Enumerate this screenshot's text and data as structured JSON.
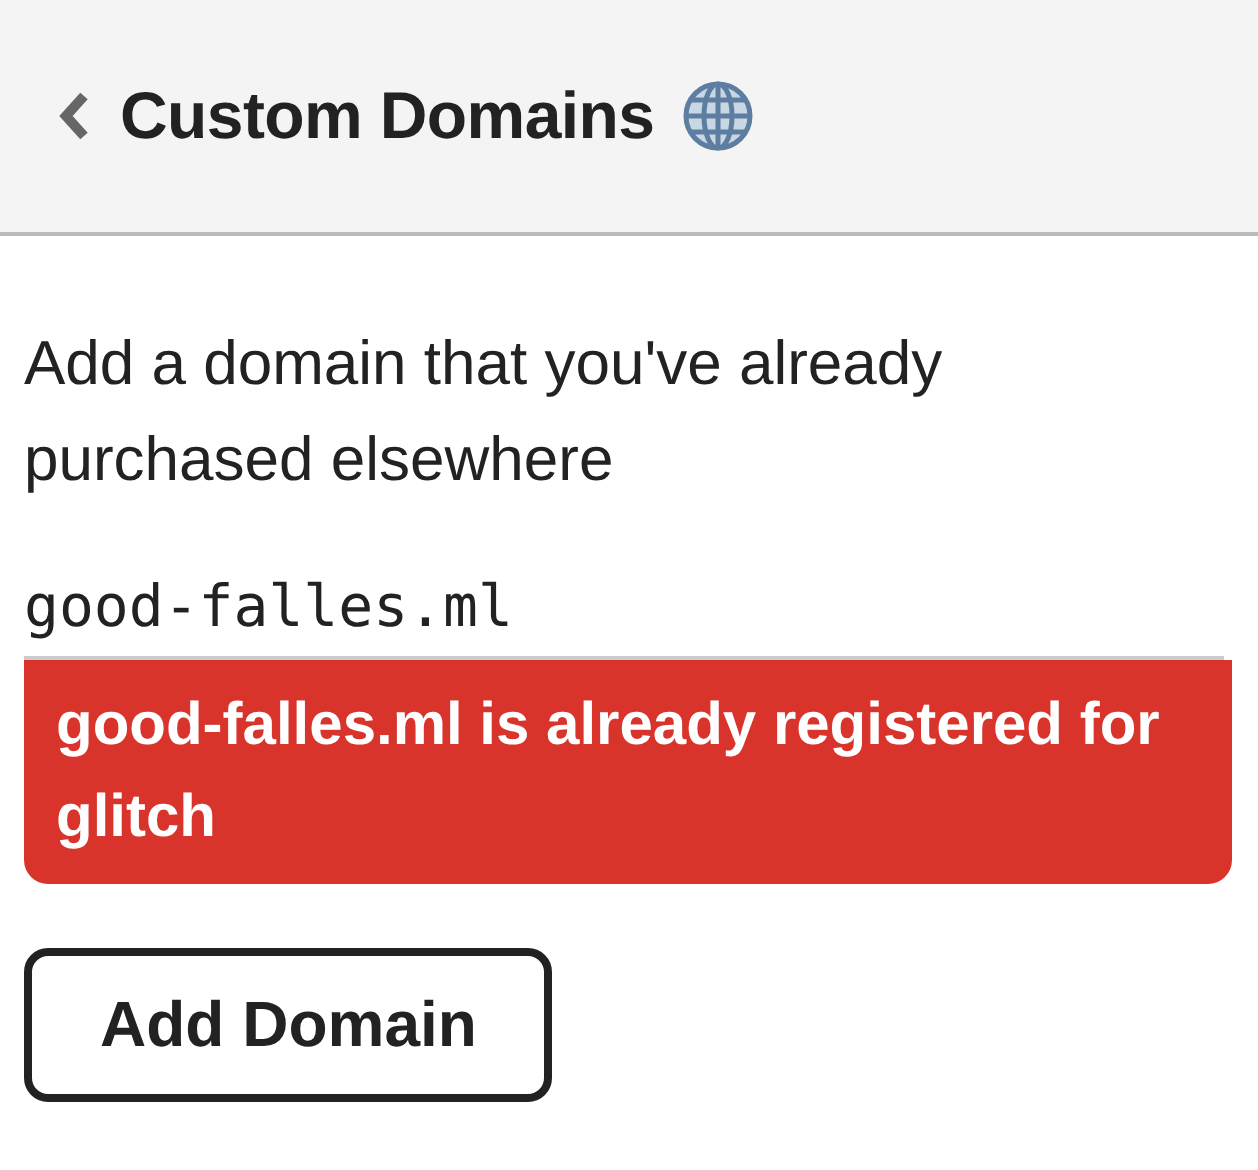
{
  "header": {
    "title": "Custom Domains"
  },
  "description": "Add a domain that you've already purchased elsewhere",
  "domain_field": {
    "value": "good-falles.ml"
  },
  "error": "good-falles.ml is already registered for glitch",
  "buttons": [
    "Add Domain"
  ]
}
